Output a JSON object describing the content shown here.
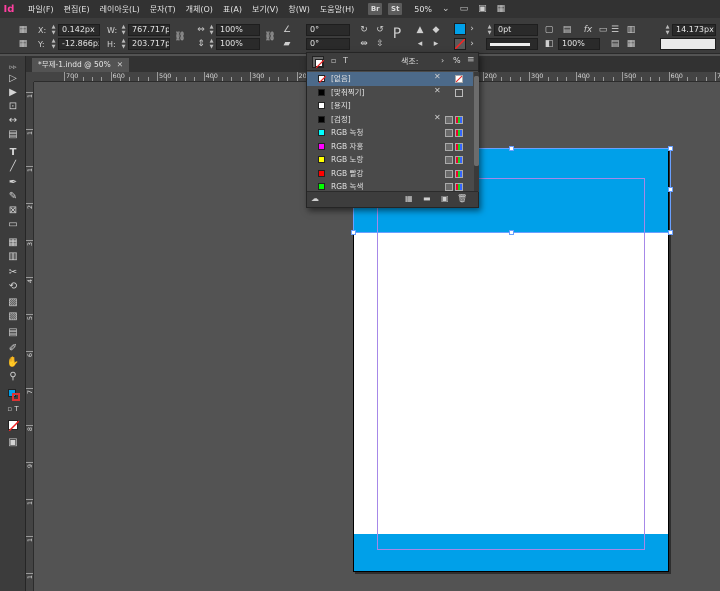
{
  "app": {
    "logo": "Id"
  },
  "menubar": {
    "items": [
      "파일(F)",
      "편집(E)",
      "레이아웃(L)",
      "문자(T)",
      "개체(O)",
      "표(A)",
      "보기(V)",
      "창(W)",
      "도움말(H)"
    ],
    "bridge_badge": "Br",
    "stock_badge": "St",
    "zoom": "50%"
  },
  "control": {
    "x_label": "X:",
    "x_value": "0.142px",
    "y_label": "Y:",
    "y_value": "-12.866px",
    "w_label": "W:",
    "w_value": "767.717px",
    "h_label": "H:",
    "h_value": "203.717px",
    "scale_x": "100%",
    "scale_y": "100%",
    "angle": "0°",
    "shear": "0°",
    "stroke_weight": "0pt",
    "opacity": "100%",
    "ref_size": "14.173px"
  },
  "tab": {
    "title": "*무제-1.indd @ 50%",
    "close": "✕"
  },
  "ruler": {
    "top_labels": [
      "700",
      "600",
      "500",
      "400",
      "300",
      "200",
      "100",
      "0",
      "100",
      "200",
      "300",
      "400",
      "500",
      "600",
      "700"
    ],
    "left_labels": [
      "1",
      "1",
      "1",
      "2",
      "3",
      "4",
      "5",
      "6",
      "7",
      "8",
      "9",
      "1",
      "1",
      "1"
    ]
  },
  "swatches_panel": {
    "tab_title": "색조:",
    "tint": "%",
    "swatches": [
      {
        "name": "[없음]",
        "color": "none",
        "locked": true,
        "selected": true
      },
      {
        "name": "[맞춰찍기]",
        "color": "#000000",
        "locked": true,
        "selected": false
      },
      {
        "name": "[용지]",
        "color": "#ffffff",
        "locked": false,
        "selected": false
      },
      {
        "name": "[검정]",
        "color": "#000000",
        "locked": true,
        "selected": false
      },
      {
        "name": "RGB 녹청",
        "color": "#00ffff",
        "locked": false,
        "selected": false
      },
      {
        "name": "RGB 자홍",
        "color": "#ff00ff",
        "locked": false,
        "selected": false
      },
      {
        "name": "RGB 노랑",
        "color": "#ffff00",
        "locked": false,
        "selected": false
      },
      {
        "name": "RGB 빨강",
        "color": "#ff0000",
        "locked": false,
        "selected": false
      },
      {
        "name": "RGB 녹색",
        "color": "#00ff00",
        "locked": false,
        "selected": false
      }
    ]
  },
  "colors": {
    "fill": "#00a0e9",
    "page": "#ffffff",
    "margin_guide": "#a688e8",
    "selection": "#6aa0ff"
  }
}
